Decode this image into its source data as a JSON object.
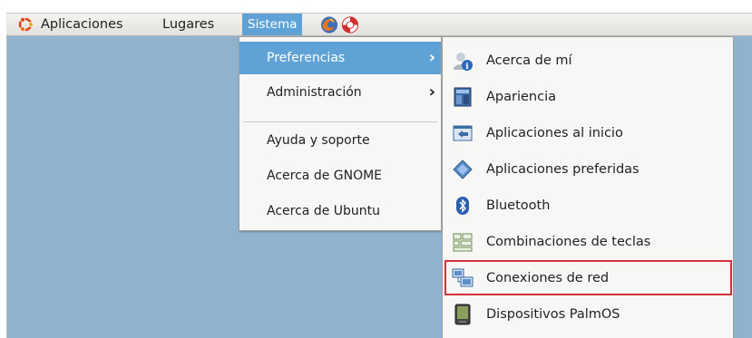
{
  "panel": {
    "aplicaciones": "Aplicaciones",
    "lugares": "Lugares",
    "sistema": "Sistema"
  },
  "sistema_menu": {
    "items": [
      {
        "label": "Preferencias",
        "has_submenu": true,
        "active": true
      },
      {
        "label": "Administración",
        "has_submenu": true,
        "active": false
      },
      {
        "label": "Ayuda y soporte"
      },
      {
        "label": "Acerca de GNOME"
      },
      {
        "label": "Acerca de Ubuntu"
      }
    ],
    "arrow": "›"
  },
  "preferencias_menu": {
    "items": [
      {
        "label": "Acerca de mí",
        "icon": "about-me-icon"
      },
      {
        "label": "Apariencia",
        "icon": "appearance-icon"
      },
      {
        "label": "Aplicaciones al inicio",
        "icon": "startup-apps-icon"
      },
      {
        "label": "Aplicaciones preferidas",
        "icon": "preferred-apps-icon"
      },
      {
        "label": "Bluetooth",
        "icon": "bluetooth-icon"
      },
      {
        "label": "Combinaciones de teclas",
        "icon": "keyboard-shortcuts-icon"
      },
      {
        "label": "Conexiones de red",
        "icon": "network-connections-icon",
        "highlighted": true
      },
      {
        "label": "Dispositivos PalmOS",
        "icon": "palmos-icon"
      }
    ]
  },
  "colors": {
    "selection": "#5fa3d6",
    "highlight_box": "#d3313b",
    "desktop": "#8fb3ce"
  }
}
